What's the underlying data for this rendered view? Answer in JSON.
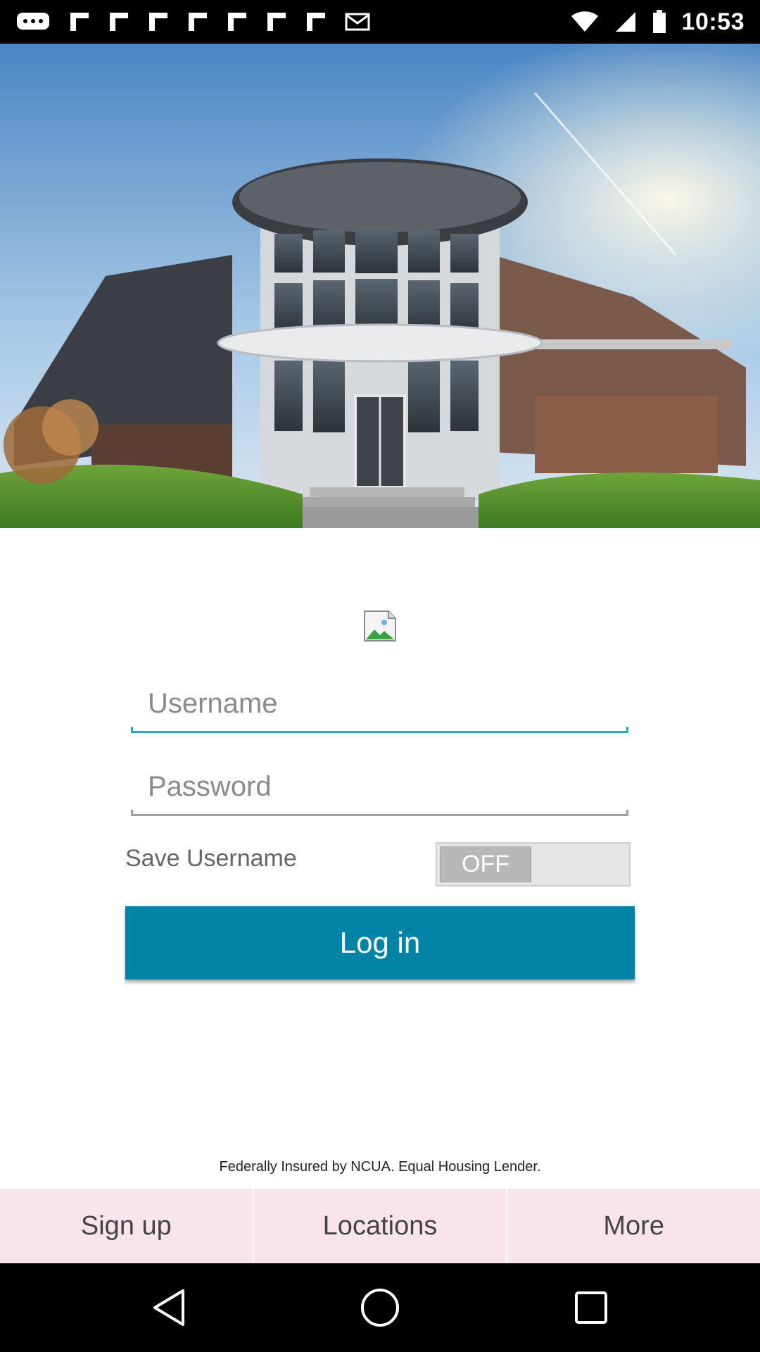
{
  "status_bar": {
    "time": "10:53"
  },
  "login_form": {
    "username_placeholder": "Username",
    "password_placeholder": "Password",
    "save_username_label": "Save Username",
    "save_username_toggle": "OFF",
    "login_button": "Log in"
  },
  "footer": {
    "notice": "Federally Insured by NCUA. Equal Housing Lender."
  },
  "tabs": [
    {
      "label": "Sign up"
    },
    {
      "label": "Locations"
    },
    {
      "label": "More"
    }
  ],
  "icons": {
    "nav_back": "back-triangle-icon",
    "nav_home": "home-circle-icon",
    "nav_recents": "recents-square-icon"
  },
  "colors": {
    "primary": "#0083a5",
    "active_input": "#2aa7c9",
    "tab_background": "#f8e4ec"
  }
}
